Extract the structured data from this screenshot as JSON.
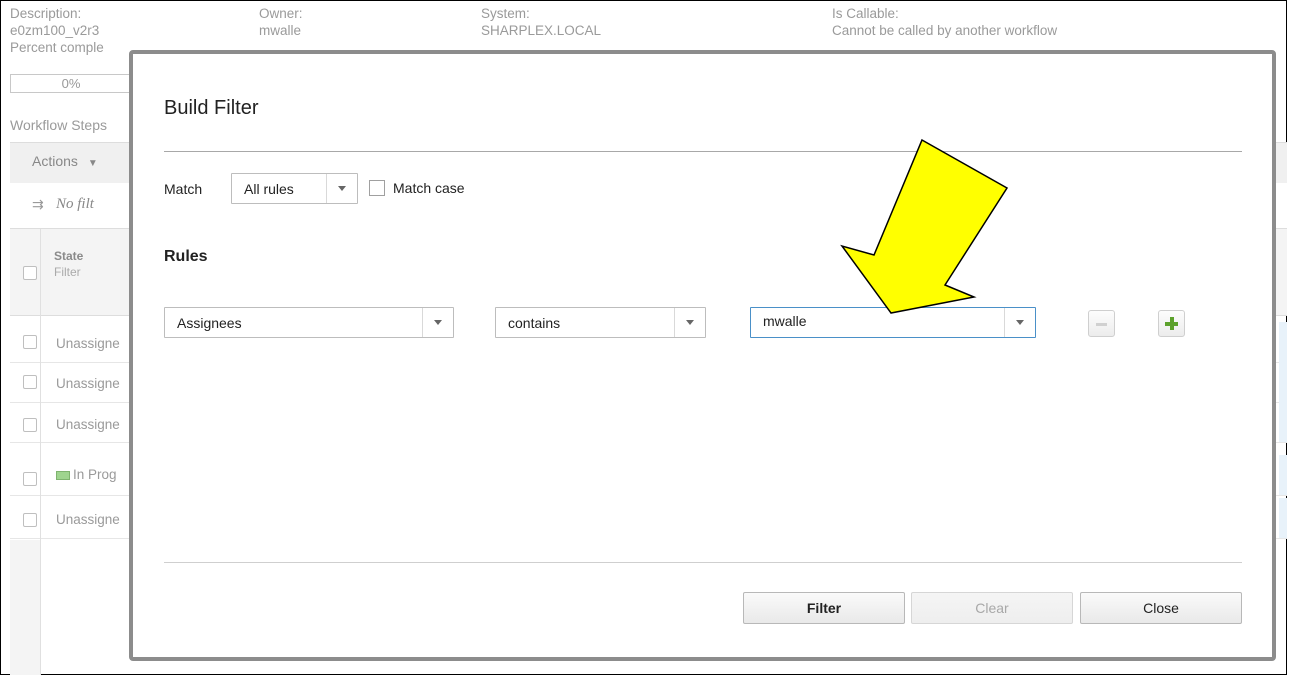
{
  "background": {
    "meta": {
      "description_label": "Description:",
      "description_value": "e0zm100_v2r3",
      "owner_label": "Owner:",
      "owner_value": "mwalle",
      "system_label": "System:",
      "system_value": "SHARPLEX.LOCAL",
      "callable_label": "Is Callable:",
      "callable_value": "Cannot be called by another workflow",
      "percent_label": "Percent comple",
      "percent_value": "0%"
    },
    "workflow_steps_label": "Workflow Steps",
    "actions_label": "Actions",
    "no_filter_label": "No filt",
    "table": {
      "state_header": "State",
      "state_filter": "Filter",
      "rows": [
        "Unassigne",
        "Unassigne",
        "Unassigne",
        "In Prog",
        "Unassigne"
      ]
    }
  },
  "modal": {
    "title": "Build Filter",
    "match_label": "Match",
    "match_value": "All rules",
    "match_case_label": "Match case",
    "rules_heading": "Rules",
    "rule": {
      "field": "Assignees",
      "operator": "contains",
      "value": "mwalle"
    },
    "buttons": {
      "filter": "Filter",
      "clear": "Clear",
      "close": "Close"
    }
  },
  "colors": {
    "annotation_arrow_fill": "#ffff00",
    "modal_border": "#8c8c8c",
    "plus_icon": "#5ca12c",
    "value_field_border": "#4a90c8"
  },
  "icons": [
    "filter-icon",
    "chevron-down-icon",
    "minus-icon",
    "plus-icon",
    "arrow-annotation"
  ]
}
